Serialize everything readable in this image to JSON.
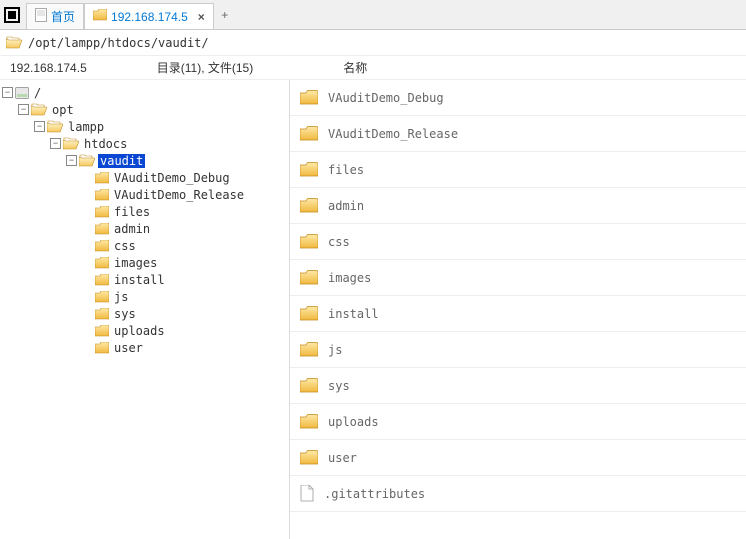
{
  "tabs": [
    {
      "label": "首页",
      "icon": "page",
      "active": false,
      "closable": false
    },
    {
      "label": "192.168.174.5",
      "icon": "folder",
      "active": true,
      "closable": true
    }
  ],
  "address": "/opt/lampp/htdocs/vaudit/",
  "status_ip": "192.168.174.5",
  "status_counts": "目录(11), 文件(15)",
  "list_header": "名称",
  "tree": [
    {
      "depth": 0,
      "toggle": "-",
      "icon": "disk",
      "label": "/",
      "selected": false
    },
    {
      "depth": 1,
      "toggle": "-",
      "icon": "folder-open",
      "label": "opt",
      "selected": false
    },
    {
      "depth": 2,
      "toggle": "-",
      "icon": "folder-open",
      "label": "lampp",
      "selected": false
    },
    {
      "depth": 3,
      "toggle": "-",
      "icon": "folder-open",
      "label": "htdocs",
      "selected": false
    },
    {
      "depth": 4,
      "toggle": "-",
      "icon": "folder-open",
      "label": "vaudit",
      "selected": true
    },
    {
      "depth": 5,
      "toggle": "",
      "icon": "folder",
      "label": "VAuditDemo_Debug",
      "selected": false
    },
    {
      "depth": 5,
      "toggle": "",
      "icon": "folder",
      "label": "VAuditDemo_Release",
      "selected": false
    },
    {
      "depth": 5,
      "toggle": "",
      "icon": "folder",
      "label": "files",
      "selected": false
    },
    {
      "depth": 5,
      "toggle": "",
      "icon": "folder",
      "label": "admin",
      "selected": false
    },
    {
      "depth": 5,
      "toggle": "",
      "icon": "folder",
      "label": "css",
      "selected": false
    },
    {
      "depth": 5,
      "toggle": "",
      "icon": "folder",
      "label": "images",
      "selected": false
    },
    {
      "depth": 5,
      "toggle": "",
      "icon": "folder",
      "label": "install",
      "selected": false
    },
    {
      "depth": 5,
      "toggle": "",
      "icon": "folder",
      "label": "js",
      "selected": false
    },
    {
      "depth": 5,
      "toggle": "",
      "icon": "folder",
      "label": "sys",
      "selected": false
    },
    {
      "depth": 5,
      "toggle": "",
      "icon": "folder",
      "label": "uploads",
      "selected": false
    },
    {
      "depth": 5,
      "toggle": "",
      "icon": "folder",
      "label": "user",
      "selected": false
    }
  ],
  "list": [
    {
      "icon": "folder-big",
      "label": "VAuditDemo_Debug"
    },
    {
      "icon": "folder-big",
      "label": "VAuditDemo_Release"
    },
    {
      "icon": "folder-big",
      "label": "files"
    },
    {
      "icon": "folder-big",
      "label": "admin"
    },
    {
      "icon": "folder-big",
      "label": "css"
    },
    {
      "icon": "folder-big",
      "label": "images"
    },
    {
      "icon": "folder-big",
      "label": "install"
    },
    {
      "icon": "folder-big",
      "label": "js"
    },
    {
      "icon": "folder-big",
      "label": "sys"
    },
    {
      "icon": "folder-big",
      "label": "uploads"
    },
    {
      "icon": "folder-big",
      "label": "user"
    },
    {
      "icon": "file",
      "label": ".gitattributes"
    }
  ]
}
